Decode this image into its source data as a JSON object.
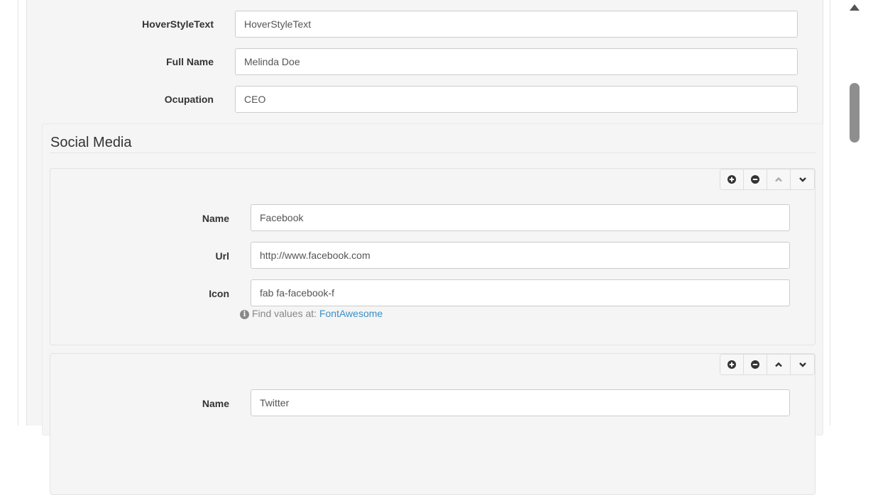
{
  "fields": {
    "hover_style": {
      "label": "HoverStyleText",
      "value": "HoverStyleText"
    },
    "full_name": {
      "label": "Full Name",
      "value": "Melinda Doe"
    },
    "occupation": {
      "label": "Ocupation",
      "value": "CEO"
    }
  },
  "social_media": {
    "title": "Social Media",
    "items": [
      {
        "name_label": "Name",
        "name_value": "Facebook",
        "url_label": "Url",
        "url_value": "http://www.facebook.com",
        "icon_label": "Icon",
        "icon_value": "fab fa-facebook-f",
        "help_text": "Find values at:",
        "help_link": "FontAwesome"
      },
      {
        "name_label": "Name",
        "name_value": "Twitter"
      }
    ]
  },
  "item_toolbar": {
    "add_icon": "plus-circle-icon",
    "remove_icon": "minus-circle-icon",
    "up_icon": "chevron-up-icon",
    "down_icon": "chevron-down-icon"
  },
  "colors": {
    "panel": "#f5f5f5",
    "link": "#3a8fc6",
    "input_border": "#cccccc"
  }
}
